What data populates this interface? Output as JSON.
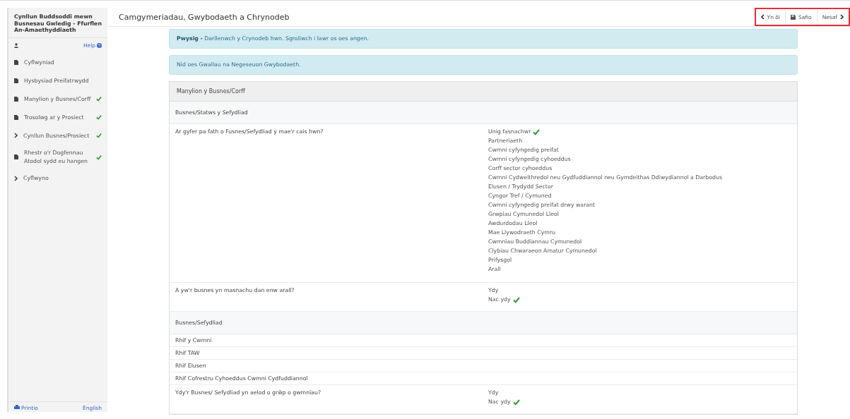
{
  "sidebar": {
    "title": "Cynllun Buddsoddi mewn Busnesau Gwledig - Ffurflen An-Amaethyddiaeth",
    "help": "Help",
    "items": [
      {
        "label": "Cyflwyniad",
        "kind": "page",
        "complete": false
      },
      {
        "label": "Hysbysiad Preifatrwydd",
        "kind": "page",
        "complete": false
      },
      {
        "label": "Manylion y Busnes/Corff",
        "kind": "page",
        "complete": true
      },
      {
        "label": "Trosolwg ar y Prosiect",
        "kind": "page",
        "complete": true
      },
      {
        "label": "Cynllun Busnes/Prosiect",
        "kind": "group",
        "complete": true
      },
      {
        "label": "Rhestr o'r Dogfennau Atodol sydd eu hangen",
        "kind": "page",
        "complete": true
      },
      {
        "label": "Cyflwyno",
        "kind": "group",
        "complete": false
      }
    ],
    "footer": {
      "print": "Printio",
      "language": "English"
    }
  },
  "header": {
    "title": "Camgymeriadau, Gwybodaeth a Chrynodeb",
    "nav": [
      {
        "label": "Yn ôl",
        "kind": "back"
      },
      {
        "label": "Safio",
        "kind": "save"
      },
      {
        "label": "Nesaf",
        "kind": "next"
      }
    ]
  },
  "alerts": [
    "**Pwysig -** Darllenwch y Crynodeb hwn. Sgroliwch i lawr os oes angen.",
    "Nid oes Gwallau na Negeseuon Gwybodaeth."
  ],
  "summary": {
    "title": "Manylion y Busnes/Corff",
    "rows": [
      {
        "kind": "section",
        "label": "Busnes/Statws y Sefydliad"
      },
      {
        "kind": "question",
        "label": "Ar gyfer pa fath o Fusnes/Sefydliad y mae'r cais hwn?",
        "options": [
          {
            "label": "Unig fasnachwr",
            "selected": true
          },
          {
            "label": "Partneriaeth",
            "selected": false
          },
          {
            "label": "Cwmni cyfyngedig preifat",
            "selected": false
          },
          {
            "label": "Cwmni cyfyngedig cyhoeddus",
            "selected": false
          },
          {
            "label": "Corff sector cyhoeddus",
            "selected": false
          },
          {
            "label": "Cwmni Cydweithredol neu Gydfuddiannol neu Gymdeithas Ddiwydiannol a Darbodus",
            "selected": false
          },
          {
            "label": "Elusen / Trydydd Sector",
            "selected": false
          },
          {
            "label": "Cyngor Tref / Cymuned",
            "selected": false
          },
          {
            "label": "Cwmni cyfyngedig preifat drwy warant",
            "selected": false
          },
          {
            "label": "Grwpiau Cymunedol Lleol",
            "selected": false
          },
          {
            "label": "Awdurdodau Lleol",
            "selected": false
          },
          {
            "label": "Mae Llywodraeth Cymru",
            "selected": false
          },
          {
            "label": "Cwmnïau Buddiannau Cymunedol",
            "selected": false
          },
          {
            "label": "Clybiau Chwaraeon Amatur Cymunedol",
            "selected": false
          },
          {
            "label": "Prifysgol",
            "selected": false
          },
          {
            "label": "Arall",
            "selected": false
          }
        ]
      },
      {
        "kind": "question",
        "label": "A yw'r busnes yn masnachu dan enw arall?",
        "options": [
          {
            "label": "Ydy",
            "selected": false
          },
          {
            "label": "Nac ydy",
            "selected": true
          }
        ]
      },
      {
        "kind": "section",
        "label": "Busnes/Sefydliad"
      },
      {
        "kind": "field",
        "label": "Rhif y Cwmni"
      },
      {
        "kind": "field",
        "label": "Rhif TAW"
      },
      {
        "kind": "field",
        "label": "Rhif Elusen"
      },
      {
        "kind": "field",
        "label": "Rhif Cofrestru Cyhoeddus Cwmni Cydfuddiannol"
      },
      {
        "kind": "question",
        "label": "Ydy'r Busnes/ Sefydliad yn aelod o grŵp o gwmnïau?",
        "options": [
          {
            "label": "Ydy",
            "selected": false
          },
          {
            "label": "Nac ydy",
            "selected": true
          }
        ]
      }
    ]
  }
}
